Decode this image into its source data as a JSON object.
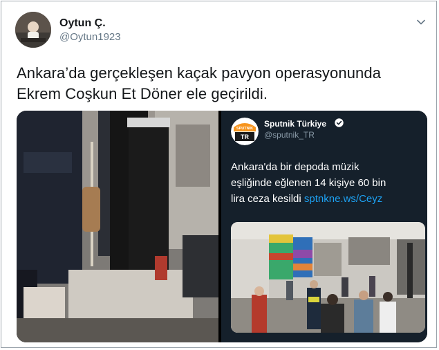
{
  "author": {
    "name": "Oytun Ç.",
    "handle": "@Oytun1923"
  },
  "tweet": {
    "line1": "Ankara’da gerçekleşen kaçak pavyon operasyonunda",
    "line2": "Ekrem Coşkun Et Döner ele geçirildi."
  },
  "embedded": {
    "logo_text": "SPUTNIK",
    "logo_badge": "TR",
    "name": "Sputnik Türkiye",
    "handle": "@sputnik_TR",
    "text_line1": "Ankara'da bir depoda müzik",
    "text_line2": "eşliğinde eğlenen 14 kişiye  60 bin",
    "text_line3": "lira ceza kesildi ",
    "link": "sptnkne.ws/Ceyz"
  },
  "icons": {
    "menu": "chevron-down-icon",
    "verified": "verified-badge-icon"
  },
  "colors": {
    "link": "#1da1f2",
    "sputnik_orange": "#f7941d",
    "dark_card": "#15202b"
  }
}
